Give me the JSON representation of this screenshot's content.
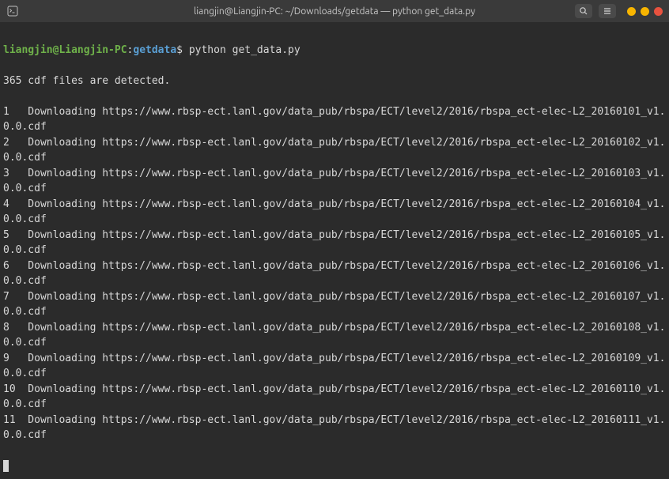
{
  "titlebar": {
    "title": "liangjin@Liangjin-PC: ~/Downloads/getdata — python get_data.py"
  },
  "prompt": {
    "userhost": "liangjin@Liangjin-PC",
    "sep1": ":",
    "dir": "getdata",
    "dollar": "$",
    "command": "python get_data.py"
  },
  "output": {
    "detected": "365 cdf files are detected.",
    "downloads": [
      {
        "n": "1",
        "url": "https://www.rbsp-ect.lanl.gov/data_pub/rbspa/ECT/level2/2016/rbspa_ect-elec-L2_20160101_v1.0.0.cdf"
      },
      {
        "n": "2",
        "url": "https://www.rbsp-ect.lanl.gov/data_pub/rbspa/ECT/level2/2016/rbspa_ect-elec-L2_20160102_v1.0.0.cdf"
      },
      {
        "n": "3",
        "url": "https://www.rbsp-ect.lanl.gov/data_pub/rbspa/ECT/level2/2016/rbspa_ect-elec-L2_20160103_v1.0.0.cdf"
      },
      {
        "n": "4",
        "url": "https://www.rbsp-ect.lanl.gov/data_pub/rbspa/ECT/level2/2016/rbspa_ect-elec-L2_20160104_v1.0.0.cdf"
      },
      {
        "n": "5",
        "url": "https://www.rbsp-ect.lanl.gov/data_pub/rbspa/ECT/level2/2016/rbspa_ect-elec-L2_20160105_v1.0.0.cdf"
      },
      {
        "n": "6",
        "url": "https://www.rbsp-ect.lanl.gov/data_pub/rbspa/ECT/level2/2016/rbspa_ect-elec-L2_20160106_v1.0.0.cdf"
      },
      {
        "n": "7",
        "url": "https://www.rbsp-ect.lanl.gov/data_pub/rbspa/ECT/level2/2016/rbspa_ect-elec-L2_20160107_v1.0.0.cdf"
      },
      {
        "n": "8",
        "url": "https://www.rbsp-ect.lanl.gov/data_pub/rbspa/ECT/level2/2016/rbspa_ect-elec-L2_20160108_v1.0.0.cdf"
      },
      {
        "n": "9",
        "url": "https://www.rbsp-ect.lanl.gov/data_pub/rbspa/ECT/level2/2016/rbspa_ect-elec-L2_20160109_v1.0.0.cdf"
      },
      {
        "n": "10",
        "url": "https://www.rbsp-ect.lanl.gov/data_pub/rbspa/ECT/level2/2016/rbspa_ect-elec-L2_20160110_v1.0.0.cdf"
      },
      {
        "n": "11",
        "url": "https://www.rbsp-ect.lanl.gov/data_pub/rbspa/ECT/level2/2016/rbspa_ect-elec-L2_20160111_v1.0.0.cdf"
      }
    ],
    "download_word": "Downloading"
  }
}
